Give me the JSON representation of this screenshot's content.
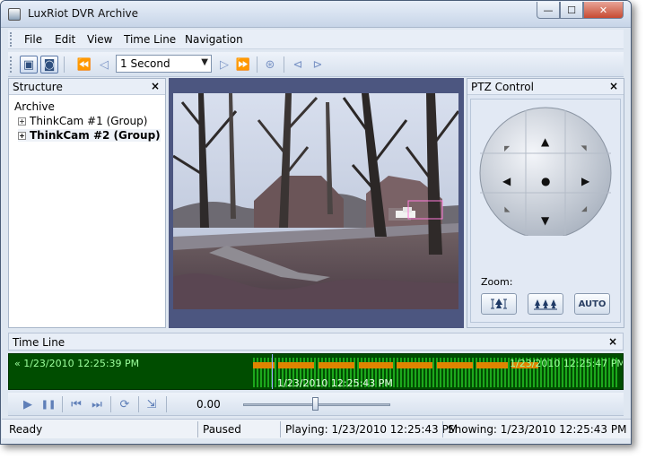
{
  "window": {
    "title": "LuxRiot DVR Archive",
    "min_glyph": "—",
    "max_glyph": "☐",
    "close_glyph": "✕"
  },
  "menu": {
    "items": [
      "File",
      "Edit",
      "View",
      "Time Line",
      "Navigation"
    ]
  },
  "toolbar": {
    "speed_value": "1 Second",
    "speed_arrow": "▼",
    "icons": {
      "view_single": "▣",
      "view_grid": "◙",
      "rewind_fast": "⏪",
      "step_back": "◁",
      "step_forward": "▷",
      "forward_fast": "⏩",
      "camera": "⊛",
      "snapshot_prev": "⊲",
      "snapshot_next": "⊳"
    }
  },
  "structure": {
    "title": "Structure",
    "close": "×",
    "root": "Archive",
    "groups": [
      "ThinkCam #1 (Group)",
      "ThinkCam #2 (Group)"
    ],
    "expander": "+"
  },
  "ptz": {
    "title": "PTZ Control",
    "close": "×",
    "zoom_label": "Zoom:",
    "auto_label": "AUTO",
    "arrows": {
      "up": "▲",
      "down": "▼",
      "left": "◀",
      "right": "▶",
      "center": "●",
      "diag": "◤"
    }
  },
  "timeline": {
    "title": "Time Line",
    "close": "×",
    "start": "« 1/23/2010 12:25:39 PM",
    "end": "1/23/2010 12:25:47 PM »",
    "current": "1/23/2010 12:25:43 PM",
    "colors": {
      "background": "#004d00",
      "activity": "#1ca81c",
      "motion": "#e08400"
    }
  },
  "playback": {
    "position": "0.00",
    "icons": {
      "play": "▶",
      "pause": "❚❚",
      "prev": "⏮",
      "next": "⏭",
      "loop": "⟳",
      "export": "⇲"
    }
  },
  "status": {
    "state": "Ready",
    "mode": "Paused",
    "playing": "Playing: 1/23/2010 12:25:43 PM",
    "showing": "Showing: 1/23/2010 12:25:43 PM"
  }
}
